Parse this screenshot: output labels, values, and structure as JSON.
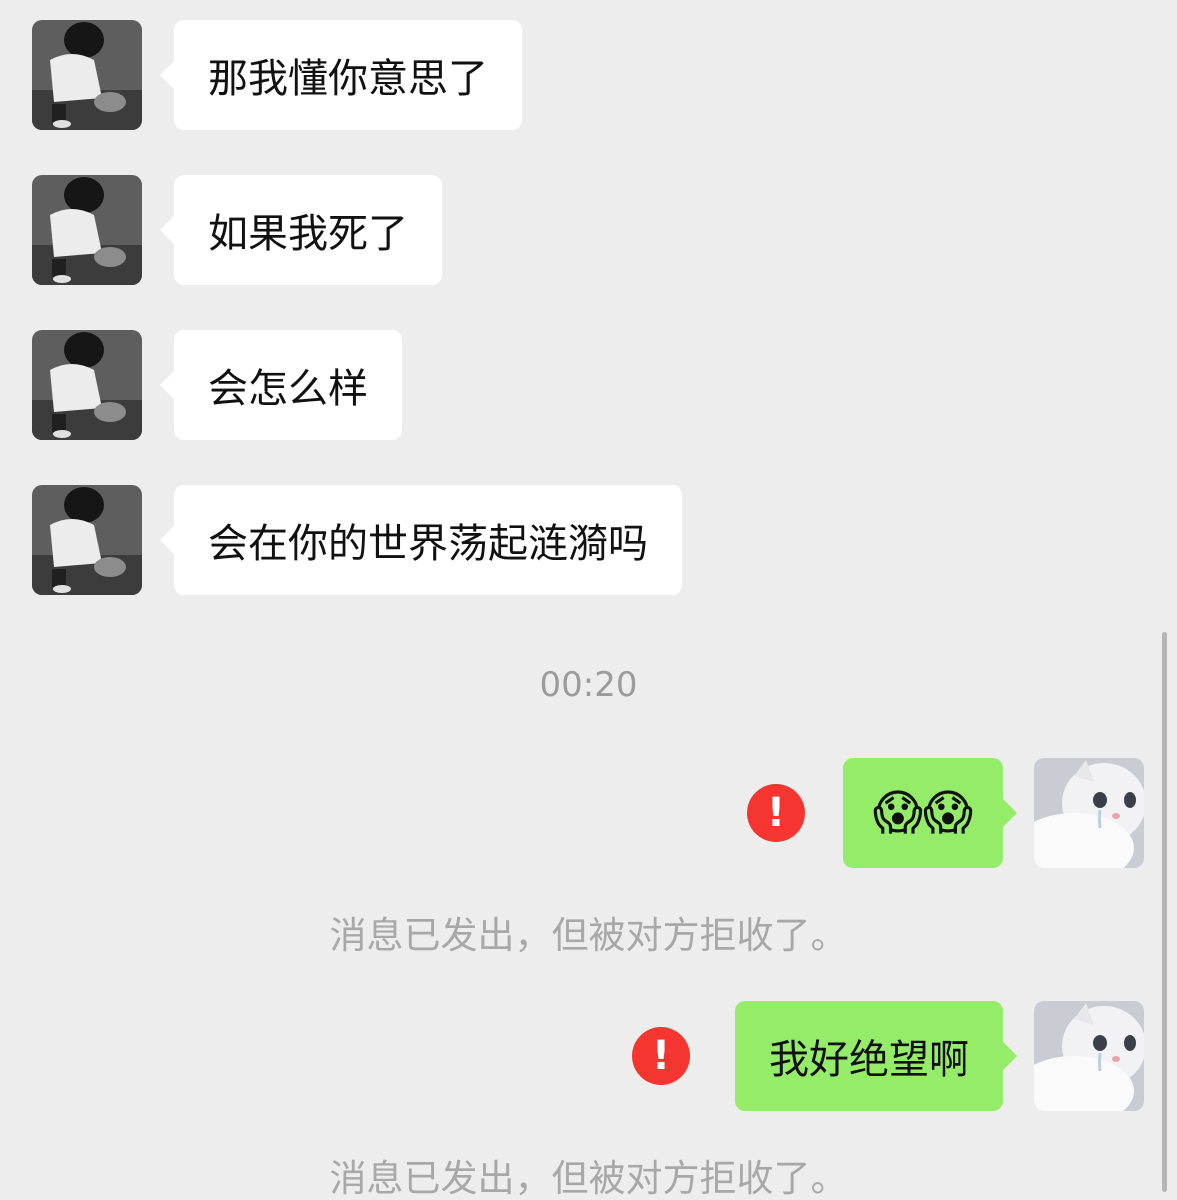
{
  "messages_in": [
    {
      "text": "那我懂你意思了"
    },
    {
      "text": "如果我死了"
    },
    {
      "text": "会怎么样"
    },
    {
      "text": "会在你的世界荡起涟漪吗"
    }
  ],
  "timestamp": "00:20",
  "messages_out": [
    {
      "text": "😱😱",
      "status_icon": "error-icon",
      "system_note": "消息已发出，但被对方拒收了。"
    },
    {
      "text": "我好绝望啊",
      "status_icon": "error-icon",
      "system_note": "消息已发出，但被对方拒收了。"
    }
  ],
  "error_glyph": "!",
  "colors": {
    "background": "#ededed",
    "incoming_bubble": "#ffffff",
    "outgoing_bubble": "#95ec69",
    "error_badge": "#f43530",
    "system_text": "#a8a8a8"
  }
}
